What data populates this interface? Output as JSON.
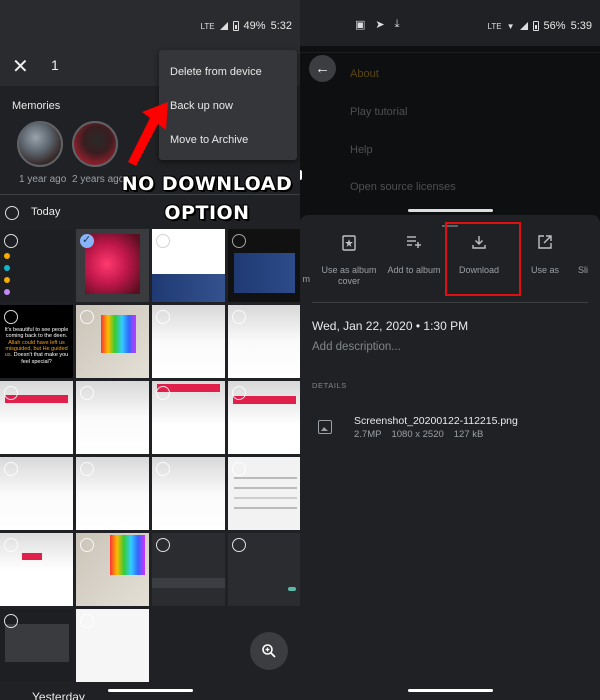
{
  "left_screen": {
    "status_bar": {
      "network": "LTE",
      "battery": "49%",
      "time": "5:32"
    },
    "selection_bar": {
      "close_icon": "close-icon",
      "selected_count": "1"
    },
    "overflow_menu": {
      "items": [
        {
          "label": "Delete from device"
        },
        {
          "label": "Back up now"
        },
        {
          "label": "Move to Archive"
        }
      ]
    },
    "memories": {
      "label": "Memories",
      "items": [
        {
          "caption": "1 year ago"
        },
        {
          "caption": "2 years ago"
        }
      ]
    },
    "section_today": "Today",
    "section_yesterday": "Yesterday",
    "annotation": {
      "line1": "NO DOWNLOAD",
      "line2": "OPTION",
      "color": "#ff0000"
    },
    "grid": {
      "tiles": [
        {
          "type": "settings-dark",
          "selected": false
        },
        {
          "type": "photo-headphones",
          "selected": true
        },
        {
          "type": "news-article",
          "selected": false
        },
        {
          "type": "news-article",
          "selected": false
        },
        {
          "type": "quote",
          "selected": false,
          "quote_white_1": "It's beautiful to see people coming back to the deen.",
          "quote_orange": "Allah could have left us misguided, but He guided us.",
          "quote_white_2": "Doesn't that make you feel special?"
        },
        {
          "type": "paint-photo",
          "selected": false
        },
        {
          "type": "blank-white",
          "selected": false
        },
        {
          "type": "text-white",
          "selected": false
        },
        {
          "type": "red-button",
          "selected": false
        },
        {
          "type": "text-white",
          "selected": false
        },
        {
          "type": "red-button",
          "selected": false
        },
        {
          "type": "red-button",
          "selected": false
        },
        {
          "type": "blank-white",
          "selected": false
        },
        {
          "type": "text-white",
          "selected": false
        },
        {
          "type": "blank-white",
          "selected": false
        },
        {
          "type": "settings-light",
          "selected": false
        },
        {
          "type": "red-button-card",
          "selected": false
        },
        {
          "type": "paint-photo",
          "selected": false
        },
        {
          "type": "developer-options",
          "selected": false
        },
        {
          "type": "usb-debugging-toggle",
          "selected": false
        },
        {
          "type": "usb-dialog",
          "selected": false
        },
        {
          "type": "twitter",
          "selected": false
        }
      ]
    },
    "zoom_button_icon": "zoom-in-icon"
  },
  "right_screen": {
    "status_bar": {
      "notification_icons": [
        "image-icon",
        "telegram-icon",
        "download-icon"
      ],
      "network": "LTE",
      "battery": "56%",
      "time": "5:39"
    },
    "background_menu": {
      "items": [
        {
          "label": "About",
          "active": true
        },
        {
          "label": "Play tutorial"
        },
        {
          "label": "Help"
        },
        {
          "label": "Open source licenses"
        }
      ]
    },
    "sheet": {
      "actions": [
        {
          "label": "Use as album cover",
          "icon": "album-cover-icon"
        },
        {
          "label": "Add to album",
          "icon": "playlist-add-icon"
        },
        {
          "label": "Download",
          "icon": "download-icon",
          "highlighted": true
        },
        {
          "label": "Use as",
          "icon": "open-in-new-icon"
        },
        {
          "label": "Sli",
          "icon": "slideshow-icon"
        }
      ],
      "partial_left_label": "m",
      "date": "Wed, Jan 22, 2020",
      "time": "1:30 PM",
      "description_placeholder": "Add description...",
      "details_label": "DETAILS",
      "file": {
        "name": "Screenshot_20200122-112215.png",
        "megapixels": "2.7MP",
        "resolution": "1080 x 2520",
        "size": "127 kB"
      }
    }
  }
}
